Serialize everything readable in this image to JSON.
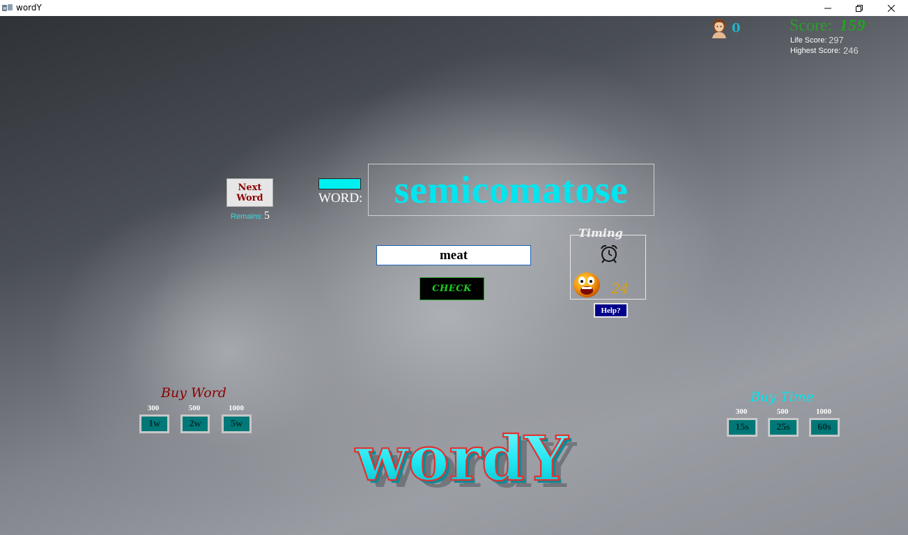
{
  "window": {
    "title": "wordY"
  },
  "player": {
    "count": "0"
  },
  "score": {
    "label": "Score:",
    "value": "159",
    "life_label": "Life Score:",
    "life_value": "297",
    "highest_label": "Highest Score:",
    "highest_value": "246"
  },
  "next_word": {
    "line1": "Next",
    "line2": "Word",
    "remains_label": "Remains:",
    "remains_value": "5"
  },
  "word": {
    "label": "WORD:",
    "text": "semicomatose"
  },
  "answer": {
    "value": "meat"
  },
  "check": {
    "label": "CHECK"
  },
  "timing": {
    "title": "Timing",
    "seconds": "24"
  },
  "help": {
    "label": "Help?"
  },
  "buy_word": {
    "title": "Buy Word",
    "items": [
      {
        "price": "300",
        "label": "1w"
      },
      {
        "price": "500",
        "label": "2w"
      },
      {
        "price": "1000",
        "label": "5w"
      }
    ]
  },
  "buy_time": {
    "title": "Buy Time",
    "items": [
      {
        "price": "300",
        "label": "15s"
      },
      {
        "price": "500",
        "label": "25s"
      },
      {
        "price": "1000",
        "label": "60s"
      }
    ]
  },
  "logo": {
    "text": "wordY"
  },
  "colors": {
    "accent_cyan": "#00e6f0",
    "score_green": "#1fa51f",
    "dark_red": "#8b0000",
    "teal_button": "#007878"
  }
}
